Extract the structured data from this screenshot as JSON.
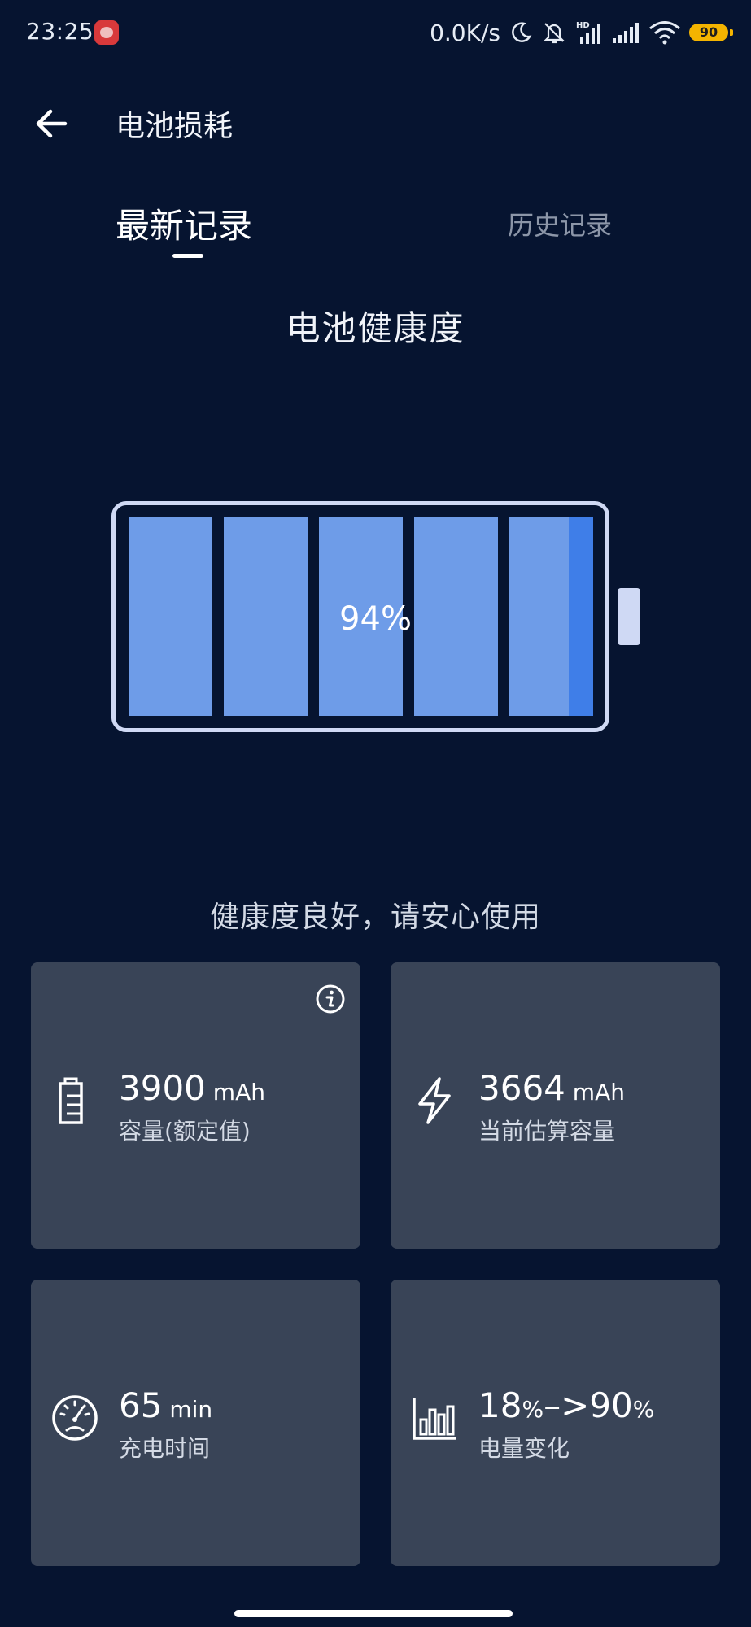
{
  "status_bar": {
    "time": "23:25",
    "net_speed": "0.0K/s",
    "battery_level": "90",
    "icons": [
      "app-notification-icon",
      "moon-icon",
      "bell-off-icon",
      "hd-signal-icon",
      "signal-icon",
      "wifi-icon",
      "battery-icon"
    ]
  },
  "header": {
    "title": "电池损耗",
    "back_icon": "back-arrow-icon"
  },
  "tabs": [
    {
      "label": "最新记录",
      "active": true
    },
    {
      "label": "历史记录",
      "active": false
    }
  ],
  "health": {
    "title": "电池健康度",
    "percent": "94%",
    "message": "健康度良好，请安心使用"
  },
  "cards": [
    {
      "icon": "battery-outline-icon",
      "value": "3900",
      "unit": " mAh",
      "label": "容量(额定值)",
      "info_icon": "info-icon"
    },
    {
      "icon": "lightning-icon",
      "value": "3664",
      "unit": " mAh",
      "label": "当前估算容量"
    },
    {
      "icon": "speedometer-icon",
      "value": "65",
      "unit": " min",
      "label": "充电时间"
    },
    {
      "icon": "bar-chart-icon",
      "value": "18",
      "unit": "%",
      "value2": "–>90",
      "unit2": "%",
      "label": "电量变化"
    }
  ],
  "colors": {
    "background": "#061430",
    "card": "#394457",
    "battery_fill": "#6e9ce8",
    "battery_accent": "#3f7ee8",
    "battery_outline": "#cfd9f4",
    "status_battery": "#f4b400"
  }
}
